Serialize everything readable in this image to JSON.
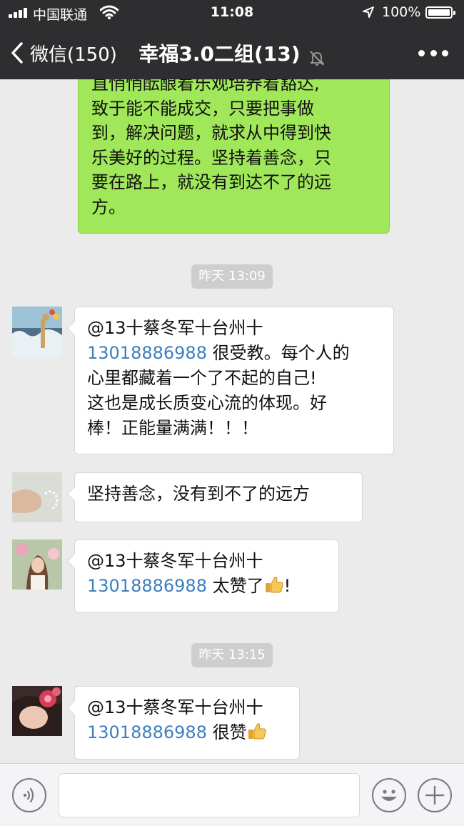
{
  "status_bar": {
    "carrier": "中国联通",
    "time": "11:08",
    "battery": "100%"
  },
  "nav": {
    "back_label": "微信(150)",
    "title": "幸福3.0二组(13)"
  },
  "messages": {
    "green": {
      "lines": [
        "直悄悄酝酿着乐观培养着豁达,",
        "致于能不能成交，只要把事做",
        "到，解决问题，就求从中得到快",
        "乐美好的过程。坚持着善念，只",
        "要在路上，就没有到达不了的远",
        "方。"
      ]
    },
    "ts1": "昨天 13:09",
    "m1": {
      "mention": "@13十蔡冬军十台州十",
      "phone": "13018886988",
      "line1_rest": " 很受教。每个人的",
      "line3": "心里都藏着一个了不起的自己!",
      "line4": "这也是成长质变心流的体现。好",
      "line5": "棒！正能量满满！！！"
    },
    "m2": {
      "text": "坚持善念，没有到不了的远方"
    },
    "m3": {
      "mention": "@13十蔡冬军十台州十",
      "phone": "13018886988",
      "rest_a": " 太赞了",
      "rest_b": "!"
    },
    "ts2": "昨天 13:15",
    "m4": {
      "mention": "@13十蔡冬军十台州十",
      "phone": "13018886988",
      "rest": " 很赞"
    }
  },
  "icons": {
    "back": "chevron-left-icon",
    "mute": "bell-off-icon",
    "more": "more-dots-icon",
    "voice": "voice-icon",
    "emoji": "emoji-icon",
    "plus": "plus-icon",
    "thumbs": "thumbs-up-icon"
  },
  "colors": {
    "header_bg": "#2e2e30",
    "chat_bg": "#ebebeb",
    "own_bubble": "#a0e75a",
    "link": "#3d7fc0"
  }
}
